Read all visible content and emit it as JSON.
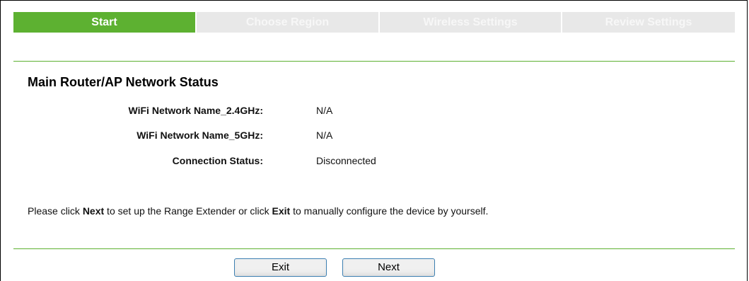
{
  "wizard": {
    "steps": [
      {
        "label": "Start",
        "active": true
      },
      {
        "label": "Choose Region",
        "active": false
      },
      {
        "label": "Wireless Settings",
        "active": false
      },
      {
        "label": "Review Settings",
        "active": false
      }
    ]
  },
  "status": {
    "heading": "Main Router/AP Network Status",
    "rows": [
      {
        "label": "WiFi Network Name_2.4GHz:",
        "value": "N/A"
      },
      {
        "label": "WiFi Network Name_5GHz:",
        "value": "N/A"
      },
      {
        "label": "Connection Status:",
        "value": "Disconnected"
      }
    ]
  },
  "instruction": {
    "part1": "Please click ",
    "next": "Next",
    "part2": " to set up the Range Extender or click ",
    "exit": "Exit",
    "part3": " to manually configure the device by yourself."
  },
  "buttons": {
    "exit_label": "Exit",
    "next_label": "Next"
  },
  "colors": {
    "accent": "#5db131",
    "inactive_tab": "#e8e8e8",
    "button_border": "#3c7fb1"
  }
}
